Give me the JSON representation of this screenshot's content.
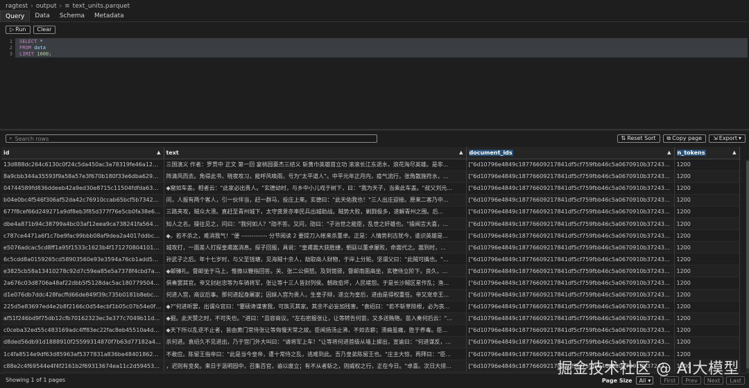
{
  "breadcrumb": {
    "parts": [
      "ragtest",
      "output",
      "text_units.parquet"
    ]
  },
  "tabs": [
    "Query",
    "Data",
    "Schema",
    "Metadata"
  ],
  "toolbar": {
    "run_label": "Run",
    "clear_label": "Clear",
    "run_icon": "play-icon"
  },
  "editor": {
    "line_numbers": [
      "1",
      "2",
      "3"
    ],
    "lines": [
      {
        "kw": "SELECT",
        "rest": " *"
      },
      {
        "kw": "FROM",
        "rest": " data"
      },
      {
        "kw": "LIMIT",
        "rest": " 1000;"
      }
    ]
  },
  "search": {
    "placeholder": "Search rows"
  },
  "actions": {
    "reset_sort": "Reset Sort",
    "copy_page": "Copy page",
    "export": "Export"
  },
  "columns": [
    "id",
    "text",
    "document_ids",
    "n_tokens"
  ],
  "rows": [
    [
      "13d888dc264c6130c0f24c5da450ac3a78319fe46a120e5614...",
      "三国演义 作者：罗贯中 正文 第一回 宴桃园豪杰三结义 斩黄巾英雄首立功 滚滚长江东逝水，浪花淘尽英雄。是非...",
      "[\"6d10796e4849c18776609217841df5cf759fbb46c5a0670910b37243f7270a...",
      "1200"
    ],
    [
      "8a9cbb344a35593f9a58a57e3f670b180f33e6dba6299e59e...",
      "阵清风而去。角得此书，晓夜攻习，能呼风唤雨，号为\"太平道人\"。中平元年正月内，疫气流行，张角散施符水，...",
      "[\"6d10796e4849c18776609217841df5cf759fbb46c5a0670910b37243f7270a...",
      "1200"
    ],
    [
      "04744589fd836ddeeb42a9ed30e8715c11504fdfda6314ae5e...",
      "◆窟如车盖。相者云：\"此家必出贵人。\"玄德幼时，与乡中小儿戏于树下，曰：\"我为天子，当乘此车盖。\"叔父刘元...",
      "[\"6d10796e4849c18776609217841df5cf759fbb46c5a0670910b37243f7270a...",
      "1200"
    ],
    [
      "b04e0bc4f546f306af52da42c76910ccab65bcf5b7342ff53cd4...",
      "间，人报有两个客人，引一伙伴当，赶一群马，投庄上来。玄德曰：\"此天佑我也！\"三人出庄迎接。原来二客乃中...",
      "[\"6d10796e4849c18776609217841df5cf759fbb46c5a0670910b37243f7270a...",
      "1200"
    ],
    [
      "677f8cef66d249271a9df8eb3f85d377f76e5cb0fa38e6344bf5...",
      "三路夹攻，贼众大溃。直赶至青州城下，太守龚景亦率民兵出城助战。贼势大败，剿戮极多，遂解青州之围。后...",
      "[\"6d10796e4849c18776609217841df5cf759fbb46c5a0670910b37243f7270a...",
      "1200"
    ],
    [
      "dbe4a871b94c38799a4bc03af12eea9ca738241fa5642ef4f8e...",
      "知人之名。操往见之，问曰：\"我何如人？\"劭不答。又问，劭曰：\"子治世之能臣，乱世之奸雄也。\"操闻言大喜，...",
      "[\"6d10796e4849c18776609217841df5cf759fbb46c5a0670910b37243f7270a...",
      "1200"
    ],
    [
      "c787ce4471a6f1c7be9fac99bbb08af9dea2a4017ddbcd1d48...",
      "◆。若不杀之，难消我气！\"便 ------------- 分节阅读 2 要提刀入帐来杀董卓。正是：人情势利古犹今，谁识英雄是...",
      "[\"6d10796e4849c18776609217841df5cf759fbb46c5a0670910b37243f7270a...",
      "1200"
    ],
    [
      "e5076adcac5cd8ff1a95f1533c1623b4f171270804101ec5644...",
      "城攻打，一面差人打探皇甫嵩消息。探子回报，具说：\"皇甫嵩大获胜捷，朝廷以董卓屡败，命嵩代之。嵩到时，...",
      "[\"6d10796e4849c18776609217841df5cf759fbb46c5a0670910b37243f7270a...",
      "1200"
    ],
    [
      "6c5cdd8a0159265cd58903560e93e3594a76cb1add5c9b2bf...",
      "孙武子之后。年十七岁时，与父至钱塘，见海贼十余人，劫取商人财物，于岸上分赃。坚谓父曰：\"此贼可擒也。\"...",
      "[\"6d10796e4849c18776609217841df5cf759fbb46c5a0670910b37243f7270a...",
      "1200"
    ],
    [
      "e3825cb58a13410278c92d7c59ea85e5a7378f4cbd7acea612...",
      "◆邮臻礼。督邮坐于马上，惟微以鞭指回答。关、张二公俱怒。及到馆驿，督邮南面高坐，玄德侍立阶下。良久，...",
      "[\"6d10796e4849c18776609217841df5cf759fbb46c5a0670910b37243f7270a...",
      "1200"
    ],
    [
      "2a676c03d8706a48af22dbb5f5128dac5ac180779504642e9e...",
      "俱奏罢其官。帝又封赵忠等为车骑将军，张让等十三人皆封列侯。朝政愈坏，人民嗟怨。于是长沙贼区星作乱；渔...",
      "[\"6d10796e4849c18776609217841df5cf759fbb46c5a0670910b37243f7270a...",
      "1200"
    ],
    [
      "d1e076db7ddc428facffd66de849f39c735b0181b8ebc24810...",
      "何进入宫，商议后事。那何进起身屠家；因妹入宫为贵人，生皇子辩，遂立为皇后，进由是得权重任。帝又宠幸王...",
      "[\"6d10796e4849c18776609217841df5cf759fbb46c5a0670910b37243f7270a...",
      "1200"
    ],
    [
      "225d5e83697ed4e2b8f2166c0d54ecbf1b05c07b54e0f3e888...",
      "◆?\"何进听罢，出谓众官曰：\"蹇硕谗谋害我，可族灭其家。其余不必妄加残害。\"袁绍曰：\"若不斩草除根，必为丧...",
      "[\"6d10796e4849c18776609217841df5cf759fbb46c5a0670910b37243f7270a...",
      "1200"
    ],
    [
      "af51f246bd9f75db12cfb70162323ec3e377c7049b11df15b85e...",
      "◆掘。此天赞之时，不可失也。\"进曰：\"且容商议。\"左右密报张让，让等转告何苗，又多送贿赂。苗入奏何后云：\"...",
      "[\"6d10796e4849c18776609217841df5cf759fbb46c5a0670910b37243f7270a...",
      "1200"
    ],
    [
      "c0ceba32ed55c483169adc4ff83ec22fac8eb45510a4d17b85e...",
      "◆天下所以乱逆不止者，皆由黄门常侍张让等侮慢天常之故。臣闻扬汤止沸，不如去薪；溃痈虽痛，胜于养毒。臣...",
      "[\"6d10796e4849c18776609217841df5cf759fbb46c5a0670910b37243f7270a...",
      "1200"
    ],
    [
      "d8ded56db91d1888910f25599314870f7b63d77182a41d5c...",
      "杀何进。袁绍久不见进出，乃于宫门外大叫曰：\"请将军上车！\"让等将何进首级从墙上掷出，宣谕曰：\"何进谋反，...",
      "[\"6d10796e4849c18776609217841df5cf759fbb46c5a0670910b37243f7270a...",
      "1200"
    ],
    [
      "1c4fa8514e9df63d85963af5377831a836be4840186232f3a0...",
      "不敢应。陈留王指帝曰：\"此是当今皇帝，遭十常侍之乱，逃难到此。吾乃皇弟陈留王也。\"庄主大惊，再拜曰：\"臣...",
      "[\"6d10796e4849c18776609217841df5cf759fbb46c5a0670910b37243f7270a...",
      "1200"
    ],
    [
      "c88e2c4f69544e4f4f2161b2f69313674ea11c2d594530d894ca...",
      "，迟则有变矣。来日于温明园中，召集百官，谕以废立；有不从者斩之，则威权之行，正在今日。\"卓喜。次日大排...",
      "[\"6d10796e4849c18776609217841df5cf759fbb46c5a0670910b37243f7270a...",
      "1200"
    ]
  ],
  "footer": {
    "showing": "Showing 1 of 1 pages",
    "page_size_label": "Page Size",
    "page_size_value": "All",
    "first": "First",
    "prev": "Prev",
    "next": "Next",
    "last": "Last"
  },
  "watermark": "掘金技术社区 @ AI大模型",
  "colors": {
    "accent": "#264f78",
    "background": "#1e1e1e"
  }
}
